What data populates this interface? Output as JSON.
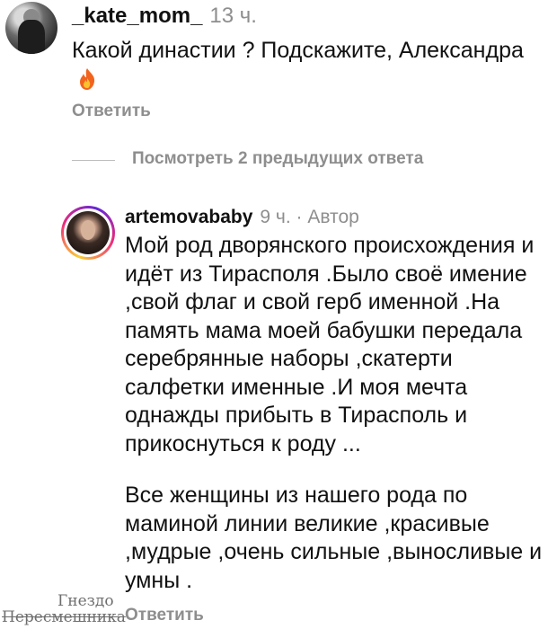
{
  "comment": {
    "username": "_kate_mom_",
    "time": "13 ч.",
    "text": "Какой династии ? Подскажите, Александра",
    "emoji_icon": "fire-icon",
    "reply_label": "Ответить"
  },
  "thread": {
    "view_replies_label": "Посмотреть 2 предыдущих ответа"
  },
  "reply": {
    "username": "artemovababy",
    "meta": "9 ч. · Автор",
    "paragraph1": "Мой род дворянского происхождения и идёт из Тирасполя .Было своё имение ,свой флаг и свой герб именной .На память мама моей бабушки передала серебрянные наборы ,скатерти салфетки именные .И моя мечта однажды прибыть в Тирасполь и прикоснуться к роду ...",
    "paragraph2": "Все женщины из нашего рода по маминой линии великие ,красивые ,мудрые ,очень сильные ,выносливые и умны .",
    "reply_label": "Ответить"
  },
  "watermark": {
    "line1": "Гнездо",
    "line2": "Пересмешника"
  },
  "colors": {
    "text": "#111111",
    "secondary": "#8e8e8e",
    "story_ring": [
      "#f9ce34",
      "#ee2a7b",
      "#6228d7"
    ]
  }
}
